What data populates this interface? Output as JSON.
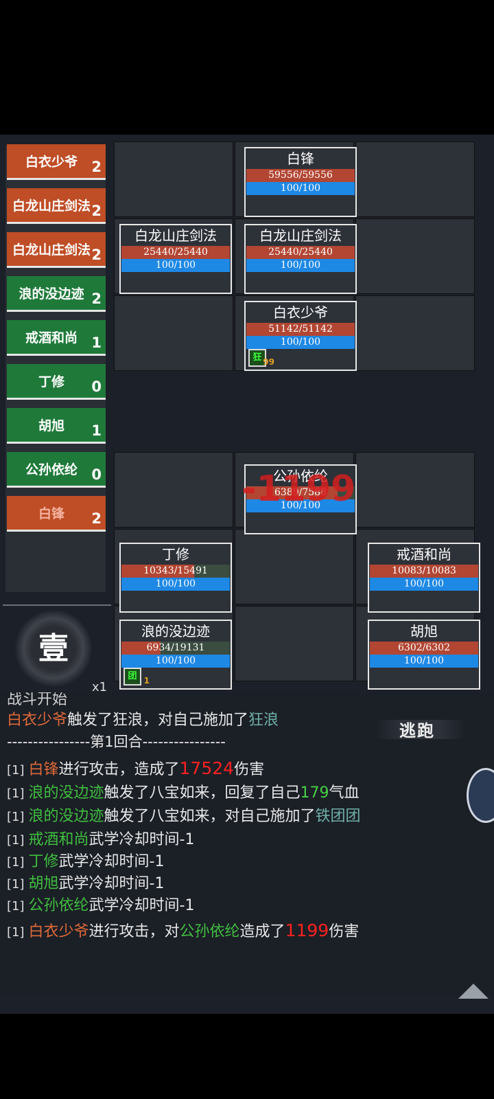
{
  "turn_order": [
    {
      "name": "白衣少爷",
      "count": "2",
      "team": "enemy"
    },
    {
      "name": "白龙山庄剑法",
      "count": "2",
      "team": "enemy"
    },
    {
      "name": "白龙山庄剑法",
      "count": "2",
      "team": "enemy"
    },
    {
      "name": "浪的没边迹",
      "count": "2",
      "team": "ally"
    },
    {
      "name": "戒酒和尚",
      "count": "1",
      "team": "ally"
    },
    {
      "name": "丁修",
      "count": "0",
      "team": "ally"
    },
    {
      "name": "胡旭",
      "count": "1",
      "team": "ally"
    },
    {
      "name": "公孙依纶",
      "count": "0",
      "team": "ally"
    },
    {
      "name": "白锋",
      "count": "2",
      "team": "enemy"
    }
  ],
  "round_icon": "壹",
  "speed": "x1",
  "enemies": {
    "bai_feng": {
      "name": "白锋",
      "hp": "59556/59556",
      "mp": "100/100",
      "hp_ratio": 1.0,
      "mp_ratio": 1.0
    },
    "sword_left": {
      "name": "白龙山庄剑法",
      "hp": "25440/25440",
      "mp": "100/100",
      "hp_ratio": 1.0,
      "mp_ratio": 1.0
    },
    "sword_right": {
      "name": "白龙山庄剑法",
      "hp": "25440/25440",
      "mp": "100/100",
      "hp_ratio": 1.0,
      "mp_ratio": 1.0
    },
    "young_master": {
      "name": "白衣少爷",
      "hp": "51142/51142",
      "mp": "100/100",
      "hp_ratio": 1.0,
      "mp_ratio": 1.0,
      "buff": "狂",
      "buff_stacks": "99"
    }
  },
  "allies": {
    "gongsun": {
      "name": "公孙依纶",
      "hp": "6389/7588",
      "mp": "100/100",
      "hp_ratio": 0.842,
      "mp_ratio": 1.0
    },
    "dingxiu": {
      "name": "丁修",
      "hp": "10343/15491",
      "mp": "100/100",
      "hp_ratio": 0.668,
      "mp_ratio": 1.0
    },
    "monk": {
      "name": "戒酒和尚",
      "hp": "10083/10083",
      "mp": "100/100",
      "hp_ratio": 1.0,
      "mp_ratio": 1.0
    },
    "langde": {
      "name": "浪的没边迹",
      "hp": "6934/19131",
      "mp": "100/100",
      "hp_ratio": 0.362,
      "mp_ratio": 1.0,
      "buff": "团",
      "buff_stacks": "1"
    },
    "huxu": {
      "name": "胡旭",
      "hp": "6302/6302",
      "mp": "100/100",
      "hp_ratio": 1.0,
      "mp_ratio": 1.0
    }
  },
  "damage_float": "-1199",
  "flee_label": "逃跑",
  "log": {
    "cut_top": "战斗开始",
    "l1": {
      "a": "白衣少爷",
      "b": "触发了狂浪，对自己施加了",
      "c": "狂浪"
    },
    "sep": "----------------第1回合----------------",
    "round_num": "[1]",
    "l2": {
      "a": "白锋",
      "b": "进行攻击，造成了",
      "c": "17524",
      "d": "伤害"
    },
    "l3": {
      "a": "浪的没边迹",
      "b": "触发了八宝如来，回复了自己",
      "c": "179",
      "d": "气血"
    },
    "l4": {
      "a": "浪的没边迹",
      "b": "触发了八宝如来，对自己施加了",
      "c": "铁团团"
    },
    "l5": {
      "a": "戒酒和尚",
      "b": "武学冷却时间-1"
    },
    "l6": {
      "a": "丁修",
      "b": "武学冷却时间-1"
    },
    "l7": {
      "a": "胡旭",
      "b": "武学冷却时间-1"
    },
    "l8": {
      "a": "公孙依纶",
      "b": "武学冷却时间-1"
    },
    "l9": {
      "a": "白衣少爷",
      "b": "进行攻击，对",
      "c": "公孙依纶",
      "d": "造成了",
      "e": "1199",
      "f": "伤害"
    }
  },
  "colors": {
    "enemy": "#bf4d26",
    "ally": "#1f7a3a",
    "hp": "#b24633",
    "mp": "#1e88e5"
  }
}
